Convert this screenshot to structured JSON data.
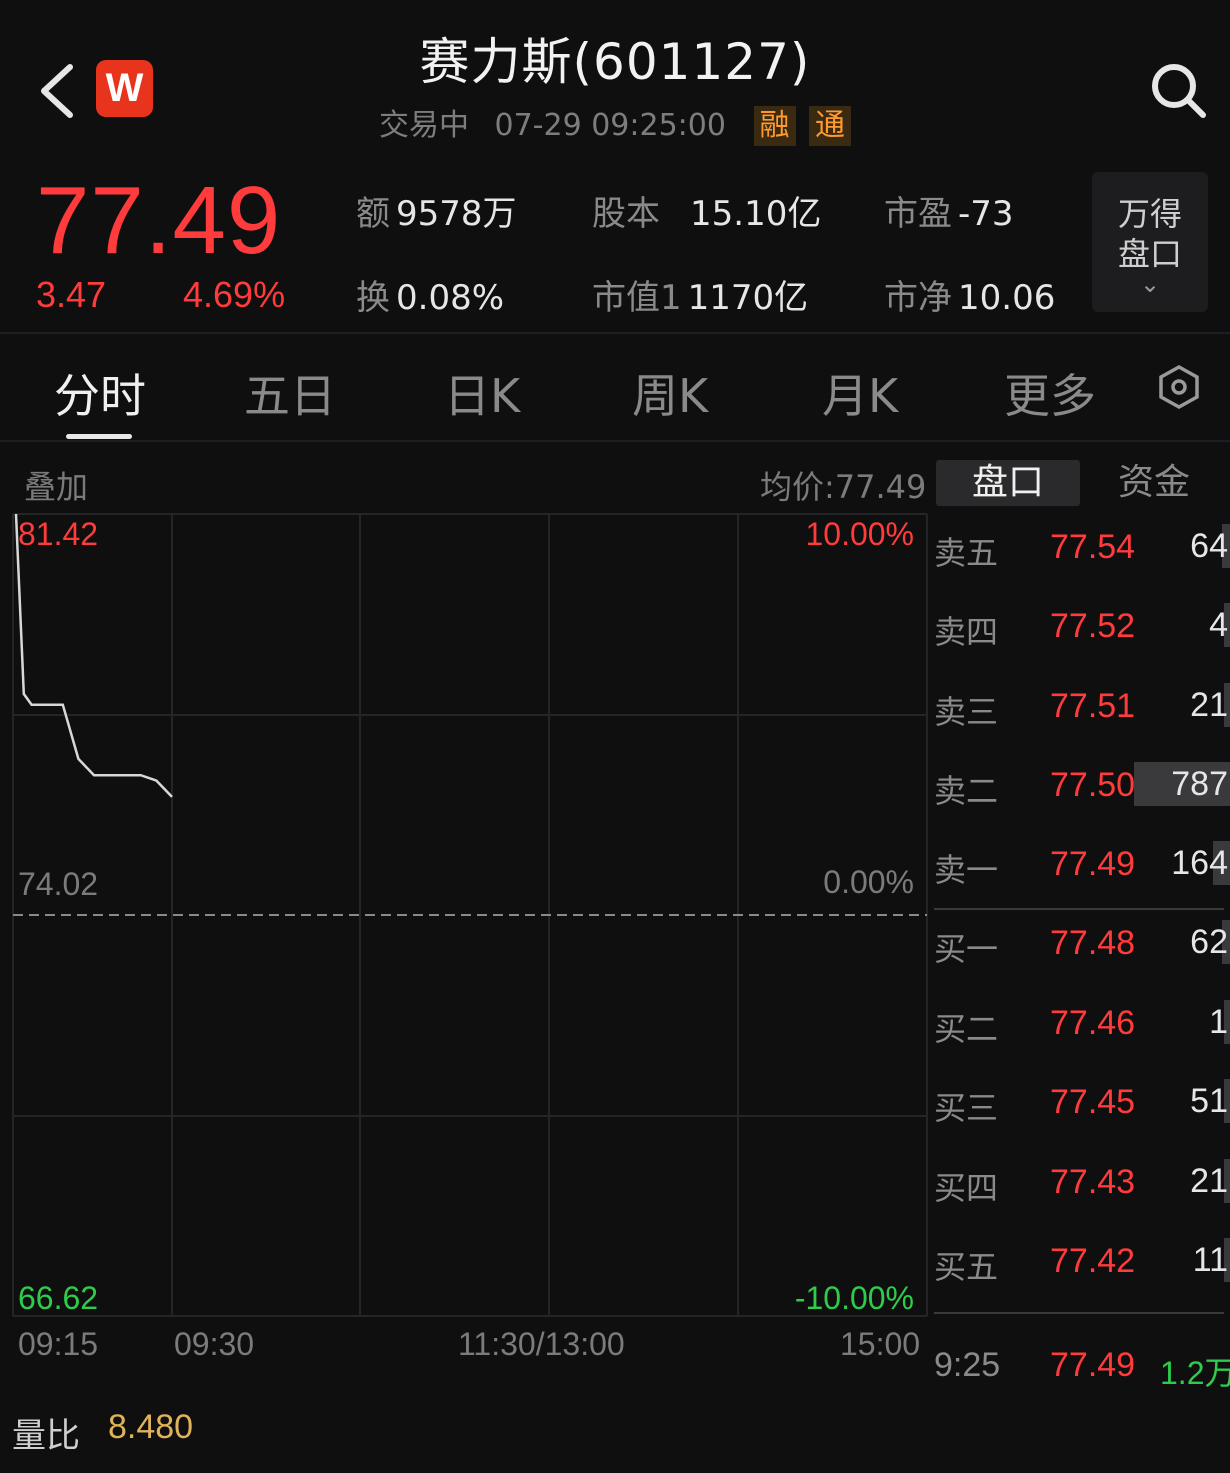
{
  "header": {
    "title": "赛力斯(601127)",
    "status": "交易中",
    "datetime": "07-29 09:25:00",
    "tags": [
      "融",
      "通"
    ],
    "logo_text": "W"
  },
  "quote": {
    "price": "77.49",
    "change": "3.47",
    "change_pct": "4.69%",
    "stats": [
      {
        "label": "额",
        "value": "9578万"
      },
      {
        "label": "股本",
        "value": "15.10亿"
      },
      {
        "label": "市盈",
        "value": "-73"
      },
      {
        "label": "换",
        "value": "0.08%"
      },
      {
        "label": "市值1",
        "value": "1170亿"
      },
      {
        "label": "市净",
        "value": "10.06"
      }
    ],
    "wande_button": {
      "line1": "万得",
      "line2": "盘口",
      "chevron": "⌄"
    }
  },
  "tabs": [
    "分时",
    "五日",
    "日K",
    "周K",
    "月K",
    "更多"
  ],
  "chart": {
    "overlay_label": "叠加",
    "avg_price": "均价:77.49",
    "y_left": {
      "top": "81.42",
      "mid": "74.02",
      "bottom": "66.62"
    },
    "y_right": {
      "top": "10.00%",
      "mid": "0.00%",
      "bottom": "-10.00%"
    },
    "x_labels": [
      "09:15",
      "09:30",
      "11:30/13:00",
      "15:00"
    ],
    "colors": {
      "up": "#ff3b3b",
      "down": "#2ecc4a",
      "line": "#d8d8d8"
    }
  },
  "chart_data": {
    "type": "line",
    "title": "",
    "xlabel": "",
    "ylabel": "",
    "ylim": [
      66.62,
      81.42
    ],
    "x": [
      "09:15",
      "09:15.5",
      "09:16",
      "09:18",
      "09:19",
      "09:20",
      "09:22",
      "09:23",
      "09:24",
      "09:25"
    ],
    "series": [
      {
        "name": "",
        "values": [
          81.42,
          78.1,
          77.9,
          77.9,
          76.9,
          76.6,
          76.6,
          76.6,
          76.5,
          76.2
        ]
      }
    ]
  },
  "orderbook": {
    "tabs": [
      "盘口",
      "资金"
    ],
    "asks": [
      {
        "label": "卖五",
        "price": "77.54",
        "vol": "64",
        "fill": 0.08
      },
      {
        "label": "卖四",
        "price": "77.52",
        "vol": "4",
        "fill": 0.02
      },
      {
        "label": "卖三",
        "price": "77.51",
        "vol": "21",
        "fill": 0.04
      },
      {
        "label": "卖二",
        "price": "77.50",
        "vol": "787",
        "fill": 1.0
      },
      {
        "label": "卖一",
        "price": "77.49",
        "vol": "164",
        "fill": 0.18
      }
    ],
    "bids": [
      {
        "label": "买一",
        "price": "77.48",
        "vol": "62",
        "fill": 0.08
      },
      {
        "label": "买二",
        "price": "77.46",
        "vol": "1",
        "fill": 0.02
      },
      {
        "label": "买三",
        "price": "77.45",
        "vol": "51",
        "fill": 0.06
      },
      {
        "label": "买四",
        "price": "77.43",
        "vol": "21",
        "fill": 0.04
      },
      {
        "label": "买五",
        "price": "77.42",
        "vol": "11",
        "fill": 0.03
      }
    ],
    "tick": {
      "time": "9:25",
      "price": "77.49",
      "vol": "1.2万"
    }
  },
  "footer": {
    "vol_ratio_label": "量比",
    "vol_ratio_value": "8.480"
  }
}
